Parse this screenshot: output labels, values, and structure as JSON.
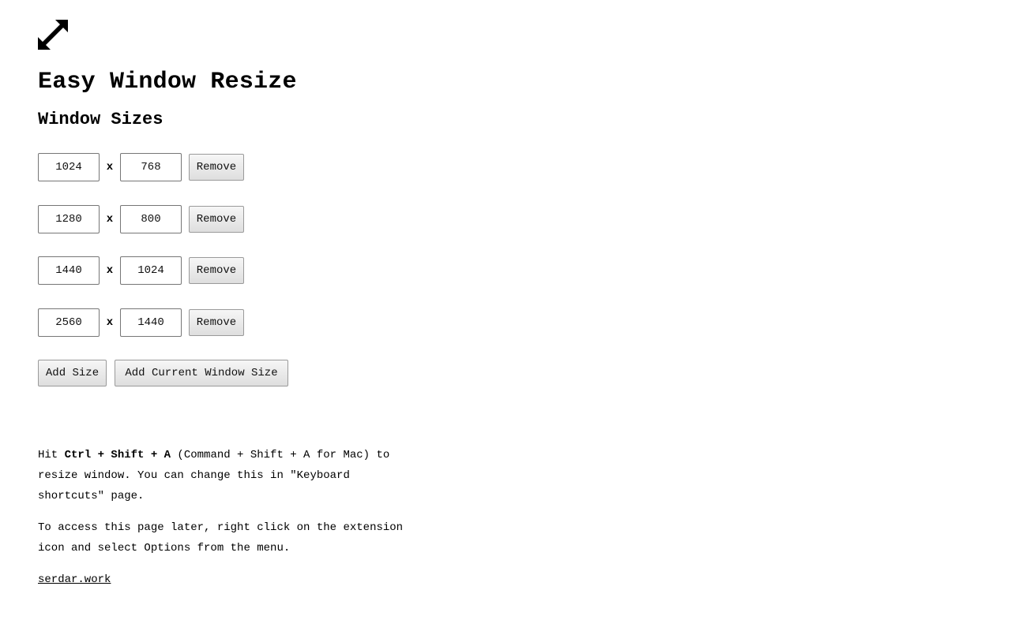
{
  "header": {
    "logo_icon": "diagonal-resize-arrows-icon",
    "title": "Easy Window Resize",
    "subtitle": "Window Sizes"
  },
  "sizes": [
    {
      "width": "1024",
      "height": "768"
    },
    {
      "width": "1280",
      "height": "800"
    },
    {
      "width": "1440",
      "height": "1024"
    },
    {
      "width": "2560",
      "height": "1440"
    }
  ],
  "labels": {
    "times": "x",
    "remove": "Remove",
    "add_size": "Add Size",
    "add_current": "Add Current Window Size"
  },
  "info": {
    "shortcut_prefix": "Hit ",
    "shortcut_keys": "Ctrl + Shift + A",
    "shortcut_suffix": " (Command + Shift + A for Mac) to resize window. You can change this in \"Keyboard shortcuts\" page.",
    "access_text": "To access this page later, right click on the extension icon and select Options from the menu.",
    "link_text": "serdar.work"
  }
}
